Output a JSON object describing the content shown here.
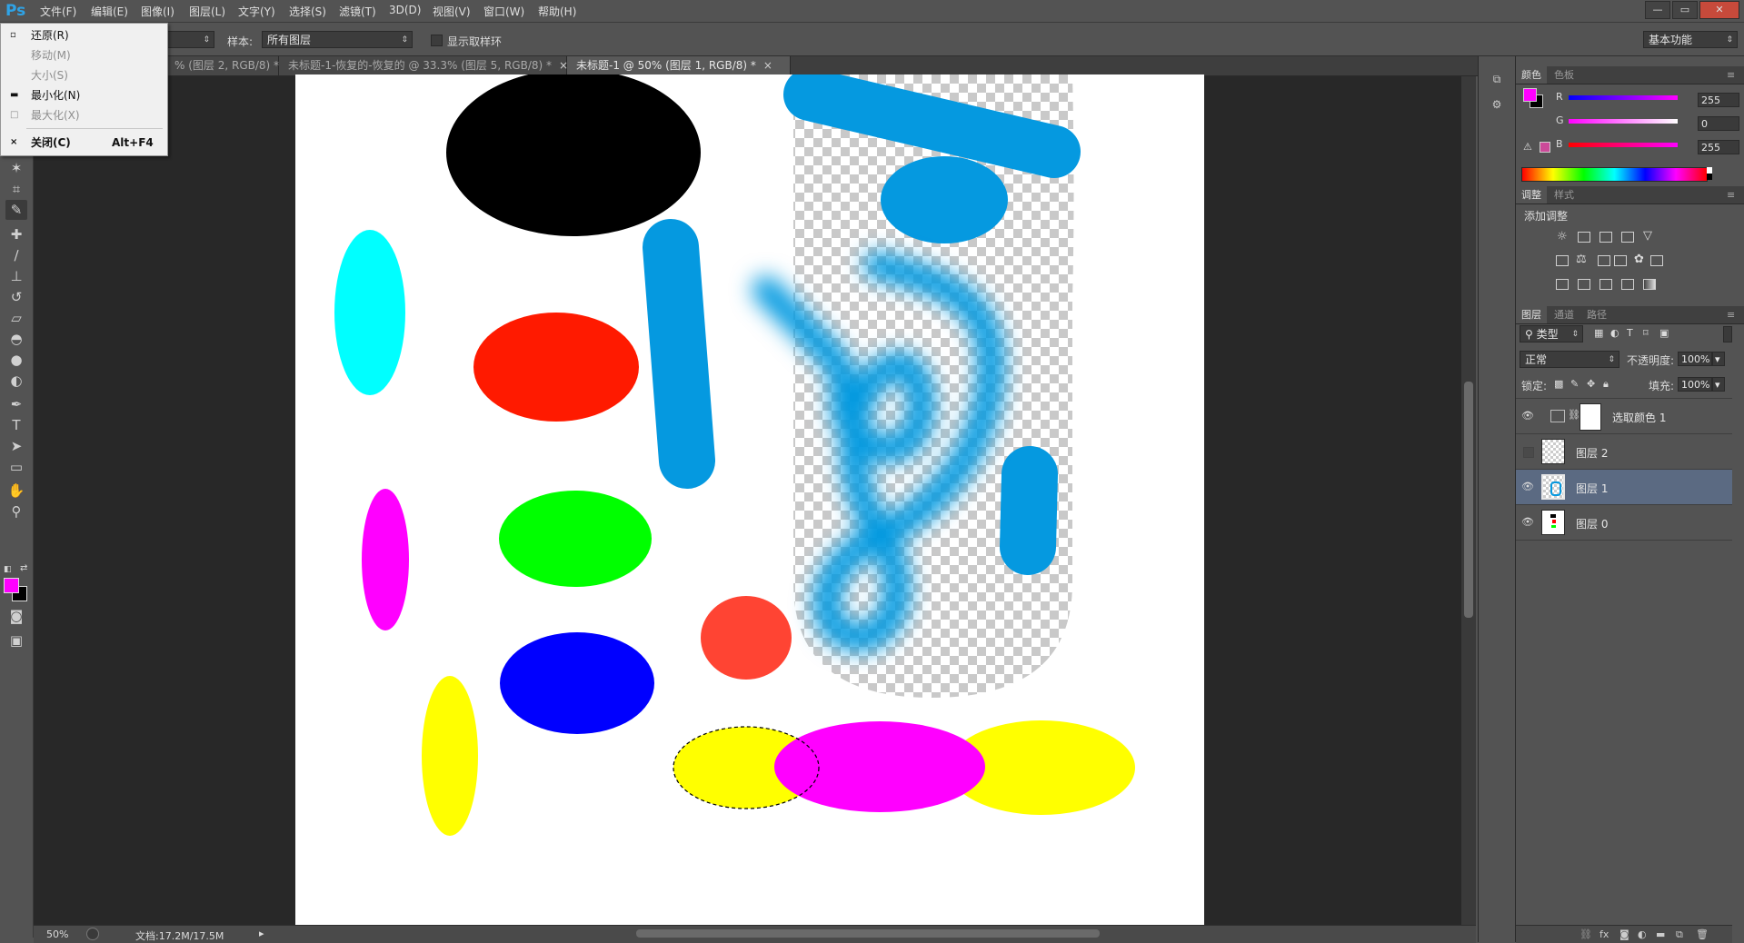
{
  "app": {
    "logo": "Ps"
  },
  "menubar": {
    "items": [
      "文件(F)",
      "编辑(E)",
      "图像(I)",
      "图层(L)",
      "文字(Y)",
      "选择(S)",
      "滤镜(T)",
      "3D(D)",
      "视图(V)",
      "窗口(W)",
      "帮助(H)"
    ],
    "window_buttons": [
      "—",
      "▭",
      "✕"
    ]
  },
  "system_menu": {
    "items": [
      {
        "icon": "▫",
        "label": "还原(R)",
        "enabled": true
      },
      {
        "label": "移动(M)",
        "enabled": false
      },
      {
        "label": "大小(S)",
        "enabled": false
      },
      {
        "icon": "▬",
        "label": "最小化(N)",
        "enabled": true
      },
      {
        "icon": "□",
        "label": "最大化(X)",
        "enabled": false
      },
      {
        "icon": "×",
        "label": "关闭(C)",
        "accelerator": "Alt+F4",
        "enabled": true
      }
    ]
  },
  "options_bar": {
    "sample_label": "样本:",
    "sample_value": "所有图层",
    "show_ring_label": "显示取样环",
    "workspace_value": "基本功能"
  },
  "tabs": [
    {
      "label": "% (图层 2, RGB/8) *",
      "close": "×",
      "active": false
    },
    {
      "label": "未标题-1-恢复的-恢复的 @ 33.3% (图层 5, RGB/8) *",
      "close": "×",
      "active": false
    },
    {
      "label": "未标题-1 @ 50% (图层 1, RGB/8) *",
      "close": "×",
      "active": true
    }
  ],
  "status": {
    "zoom": "50%",
    "doc_info": "文档:17.2M/17.5M"
  },
  "colors": {
    "foreground": "#ff00ff",
    "background": "#000000",
    "accent_selection": "#5b6a82",
    "canvas_blue": "#0599e0"
  },
  "color_panel": {
    "tabs": [
      "颜色",
      "色板"
    ],
    "channels": [
      {
        "name": "R",
        "value": "255",
        "level": 1.0
      },
      {
        "name": "G",
        "value": "0",
        "level": 0.0
      },
      {
        "name": "B",
        "value": "255",
        "level": 1.0
      }
    ]
  },
  "adjustments_panel": {
    "tabs": [
      "调整",
      "样式"
    ],
    "title": "添加调整"
  },
  "layers_panel": {
    "tabs": [
      "图层",
      "通道",
      "路径"
    ],
    "filter_kind": "类型",
    "blend_mode": "正常",
    "opacity_label": "不透明度:",
    "opacity_value": "100%",
    "lock_label": "锁定:",
    "fill_label": "填充:",
    "fill_value": "100%",
    "layers": [
      {
        "name": "选取颜色 1",
        "visible": true,
        "selected": false,
        "kind": "adjustment"
      },
      {
        "name": "图层 2",
        "visible": false,
        "selected": false,
        "kind": "transparent"
      },
      {
        "name": "图层 1",
        "visible": true,
        "selected": true,
        "kind": "blue"
      },
      {
        "name": "图层 0",
        "visible": true,
        "selected": false,
        "kind": "white"
      }
    ]
  }
}
